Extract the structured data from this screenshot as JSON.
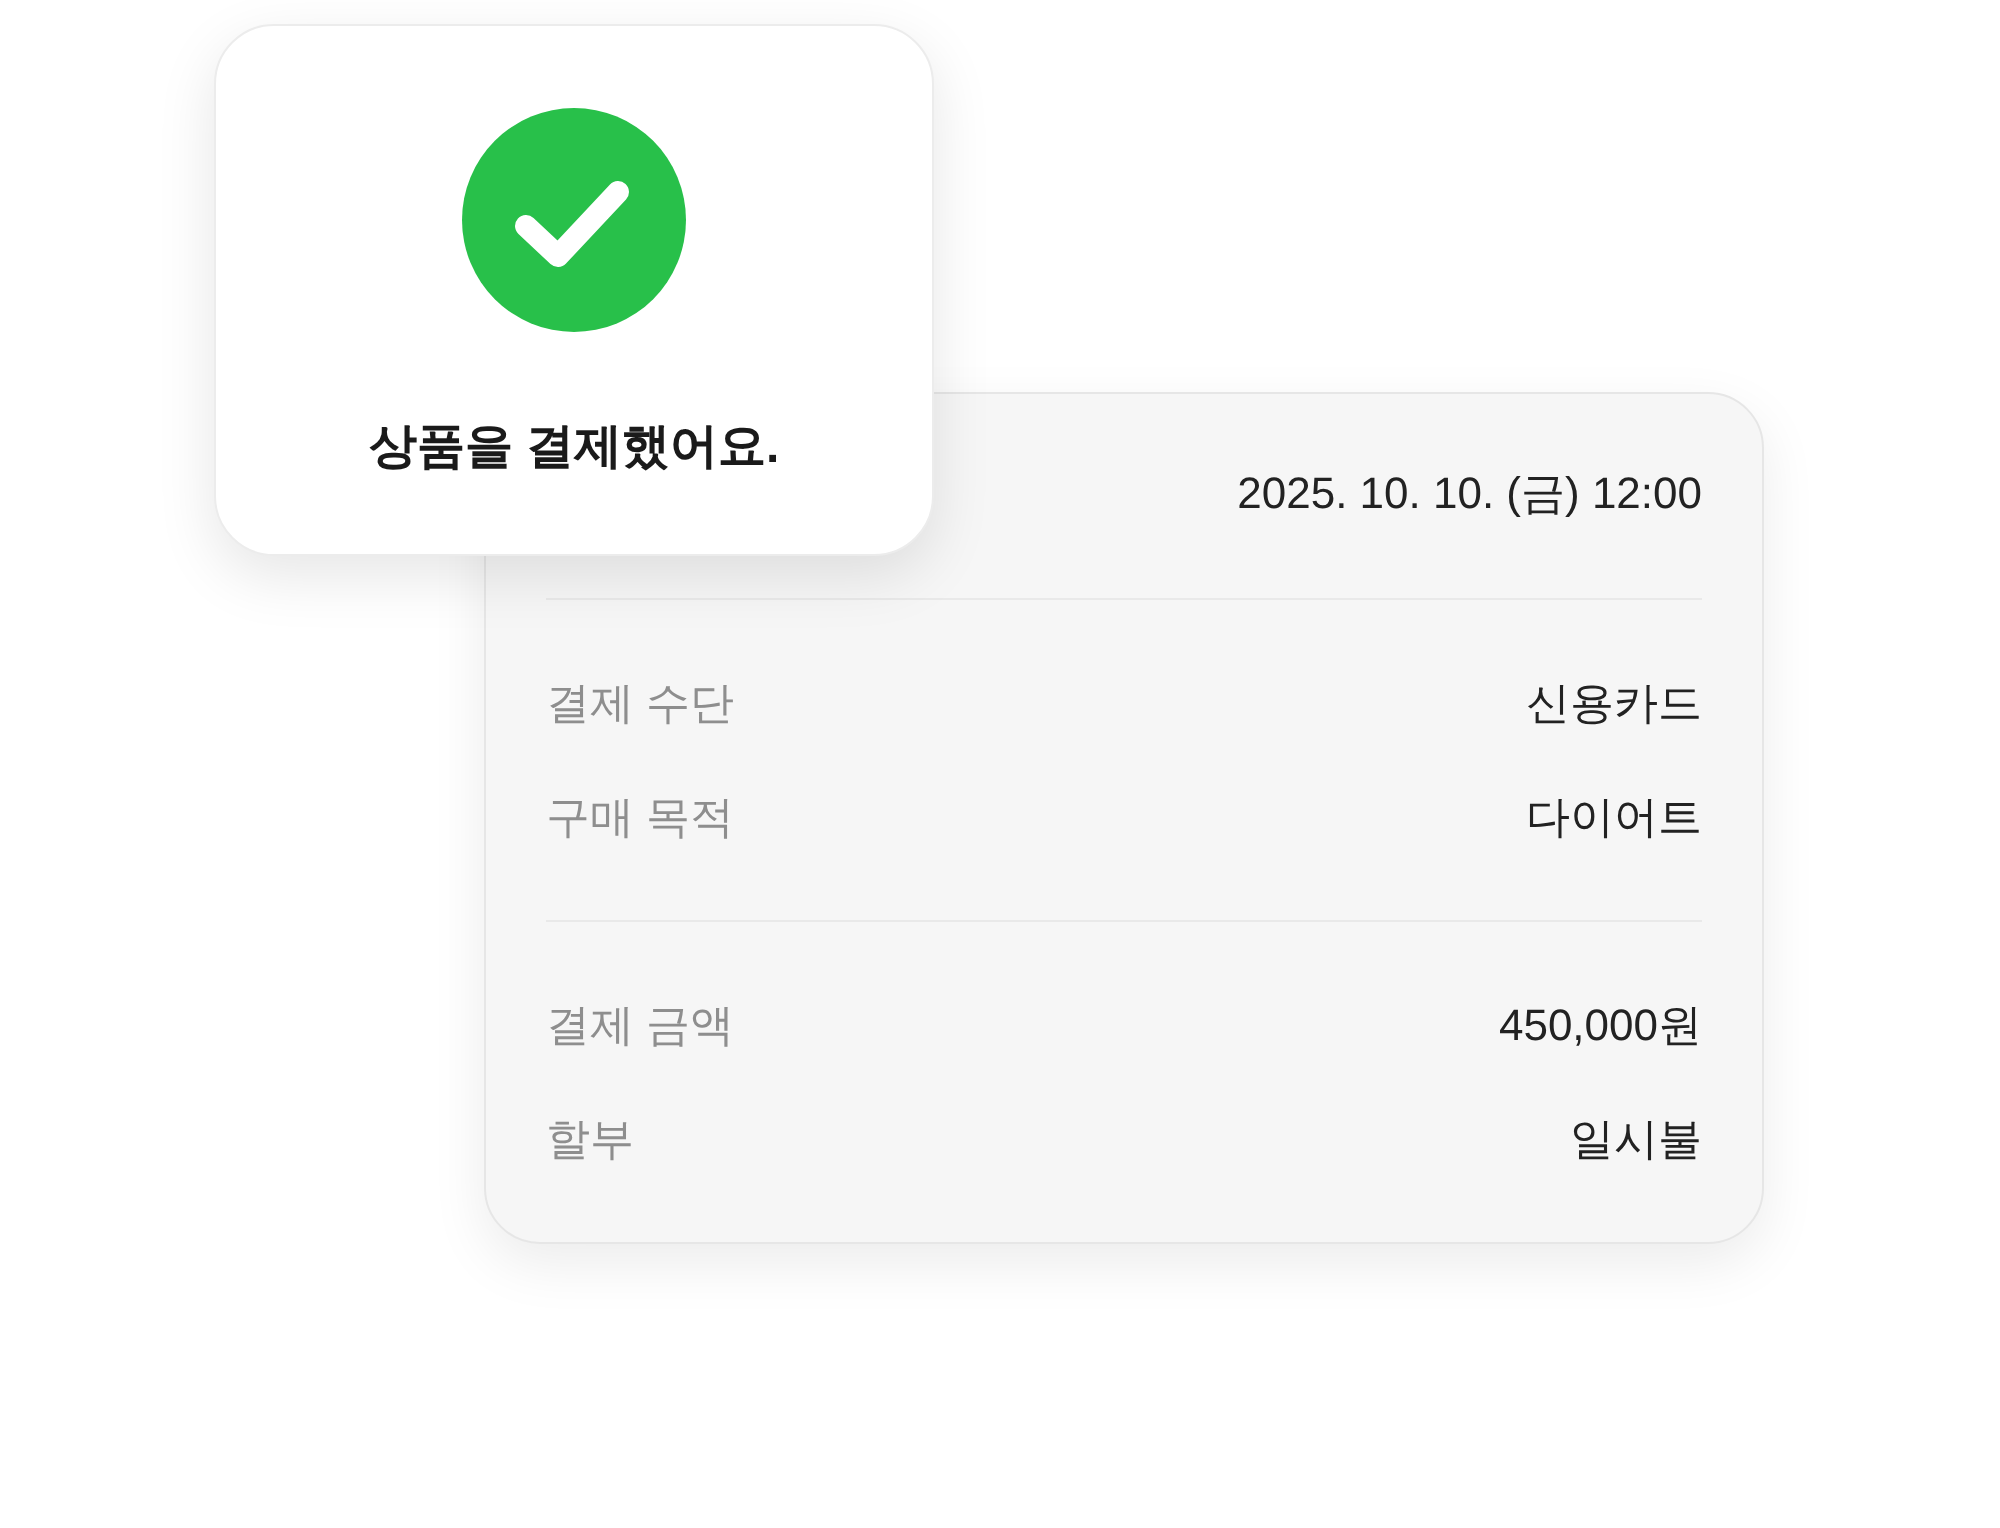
{
  "toast": {
    "message": "상품을 결제했어요."
  },
  "receipt": {
    "datetime": "2025. 10. 10. (금) 12:00",
    "sections": [
      {
        "rows": [
          {
            "label": "결제 수단",
            "value": "신용카드"
          },
          {
            "label": "구매 목적",
            "value": "다이어트"
          }
        ]
      },
      {
        "rows": [
          {
            "label": "결제 금액",
            "value": "450,000원"
          },
          {
            "label": "할부",
            "value": "일시불"
          }
        ]
      }
    ]
  }
}
